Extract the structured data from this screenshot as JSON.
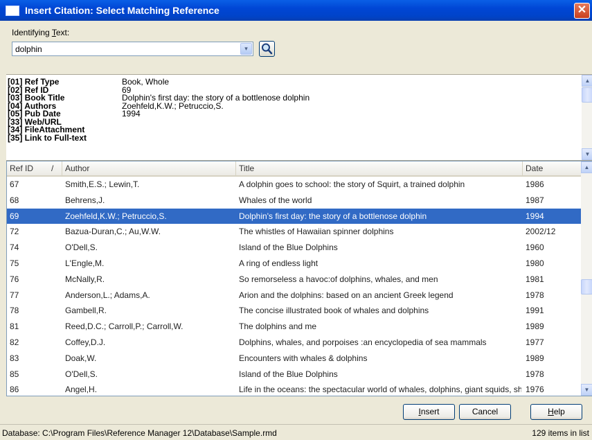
{
  "window": {
    "title": "Insert Citation: Select Matching Reference",
    "close_glyph": "✕"
  },
  "search": {
    "label_prefix": "Identifying ",
    "label_access_key": "T",
    "label_suffix": "ext:",
    "value": "dolphin",
    "dropdown_glyph": "▾"
  },
  "details": [
    {
      "key": "[01] Ref Type",
      "value": "Book, Whole"
    },
    {
      "key": "[02] Ref ID",
      "value": "69"
    },
    {
      "key": "[03] Book Title",
      "value": "Dolphin's first day: the story of a bottlenose dolphin"
    },
    {
      "key": "[04] Authors",
      "value": "Zoehfeld,K.W.; Petruccio,S."
    },
    {
      "key": "[05] Pub Date",
      "value": "1994"
    },
    {
      "key": "[33] Web/URL",
      "value": ""
    },
    {
      "key": "[34] FileAttachment",
      "value": ""
    },
    {
      "key": "[35] Link to Full-text",
      "value": ""
    }
  ],
  "grid": {
    "columns": {
      "ref_id": "Ref ID",
      "sort_glyph": "/",
      "author": "Author",
      "title": "Title",
      "date": "Date"
    },
    "rows": [
      {
        "id": "67",
        "author": "Smith,E.S.; Lewin,T.",
        "title": "A dolphin goes to school: the story of Squirt, a trained dolphin",
        "date": "1986"
      },
      {
        "id": "68",
        "author": "Behrens,J.",
        "title": "Whales of the world",
        "date": "1987"
      },
      {
        "id": "69",
        "author": "Zoehfeld,K.W.; Petruccio,S.",
        "title": "Dolphin's first day: the story of a bottlenose dolphin",
        "date": "1994",
        "selected": true
      },
      {
        "id": "72",
        "author": "Bazua-Duran,C.; Au,W.W.",
        "title": "The whistles of Hawaiian spinner dolphins",
        "date": "2002/12"
      },
      {
        "id": "74",
        "author": "O'Dell,S.",
        "title": "Island of the Blue Dolphins",
        "date": "1960"
      },
      {
        "id": "75",
        "author": "L'Engle,M.",
        "title": "A ring of endless light",
        "date": "1980"
      },
      {
        "id": "76",
        "author": "McNally,R.",
        "title": "So remorseless a havoc:of dolphins, whales, and men",
        "date": "1981"
      },
      {
        "id": "77",
        "author": "Anderson,L.; Adams,A.",
        "title": "Arion and the dolphins: based on an ancient Greek legend",
        "date": "1978"
      },
      {
        "id": "78",
        "author": "Gambell,R.",
        "title": "The concise illustrated book of whales and dolphins",
        "date": "1991"
      },
      {
        "id": "81",
        "author": "Reed,D.C.; Carroll,P.; Carroll,W.",
        "title": "The dolphins and me",
        "date": "1989"
      },
      {
        "id": "82",
        "author": "Coffey,D.J.",
        "title": "Dolphins, whales, and porpoises :an encyclopedia of sea mammals",
        "date": "1977"
      },
      {
        "id": "83",
        "author": "Doak,W.",
        "title": "Encounters with whales & dolphins",
        "date": "1989"
      },
      {
        "id": "85",
        "author": "O'Dell,S.",
        "title": "Island of the Blue Dolphins",
        "date": "1978"
      },
      {
        "id": "86",
        "author": "Angel,H.",
        "title": "Life in the oceans: the spectacular world of whales, dolphins, giant squids, sh",
        "date": "1976"
      }
    ]
  },
  "buttons": {
    "insert": {
      "access_key": "I",
      "rest": "nsert"
    },
    "cancel": {
      "label": "Cancel"
    },
    "help": {
      "access_key": "H",
      "rest": "elp"
    }
  },
  "scroll": {
    "up_glyph": "▲",
    "down_glyph": "▼"
  },
  "status": {
    "database": "Database: C:\\Program Files\\Reference Manager 12\\Database\\Sample.rmd",
    "count": "129 items in list"
  },
  "colors": {
    "selection": "#316ac5",
    "titlebar": "#0046d5",
    "dialog_bg": "#ece9d8"
  },
  "icons": {
    "search": "magnifier-icon",
    "close": "close-icon",
    "app": "app-icon"
  }
}
